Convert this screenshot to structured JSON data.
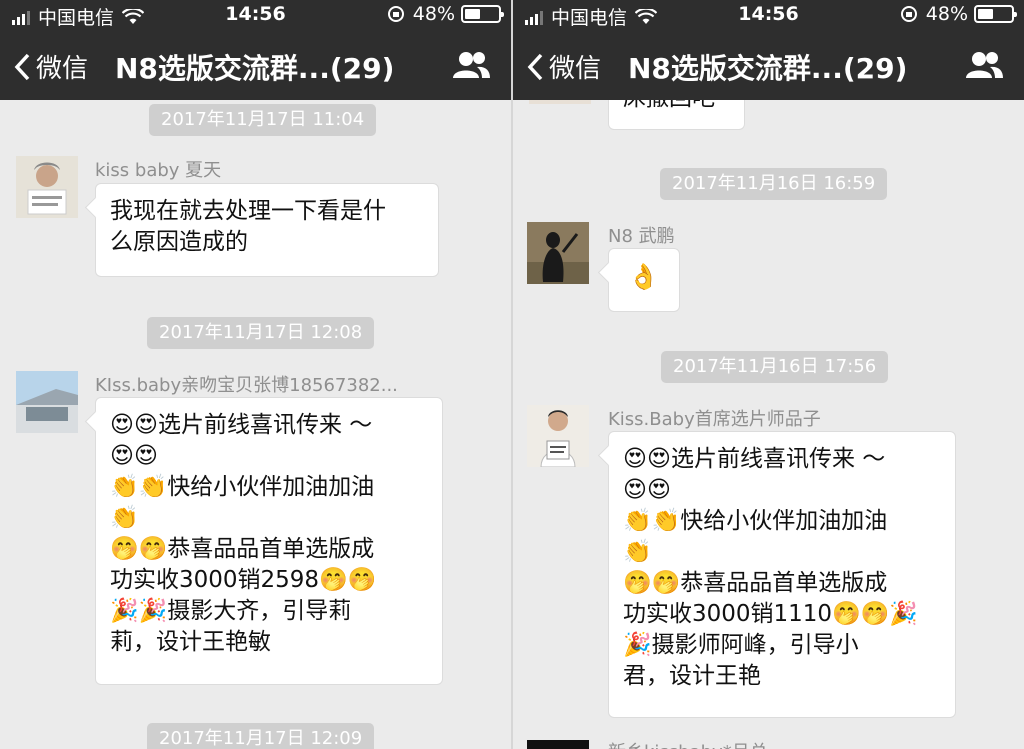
{
  "status_bar": {
    "carrier": "中国电信",
    "time": "14:56",
    "battery": "48%",
    "battery_level": 0.48
  },
  "nav": {
    "back_label": "微信",
    "title": "N8选版交流群...(29)"
  },
  "left": {
    "ts1": "2017年11月17日 11:04",
    "msg1": {
      "sender": "kiss baby 夏天",
      "lines": [
        "我现在就去处理一下看是什",
        "么原因造成的"
      ]
    },
    "ts2": "2017年11月17日 12:08",
    "msg2": {
      "sender": "KIss.baby亲吻宝贝张博18567382...",
      "lines": [
        "😍😍选片前线喜讯传来 ～",
        "😍😍",
        "👏👏快给小伙伴加油加油",
        "👏",
        "🤭🤭恭喜品品首单选版成",
        "功实收3000销2598🤭🤭",
        "🎉🎉摄影大齐，引导莉",
        "莉，设计王艳敏"
      ]
    },
    "ts3": "2017年11月17日 12:09"
  },
  "right": {
    "partial_text": "床撒回吧",
    "ts1": "2017年11月16日 16:59",
    "msg1": {
      "sender": "N8 武鹏",
      "text": "👌"
    },
    "ts2": "2017年11月16日 17:56",
    "msg2": {
      "sender": "Kiss.Baby首席选片师品子",
      "lines": [
        "😍😍选片前线喜讯传来 ～",
        "😍😍",
        "👏👏快给小伙伴加油加油",
        "👏",
        "🤭🤭恭喜品品首单选版成",
        "功实收3000销1110🤭🤭🎉",
        "🎉摄影师阿峰，引导小",
        "君，设计王艳"
      ]
    },
    "partial_sender": "新乡kissbaby*吕总"
  }
}
